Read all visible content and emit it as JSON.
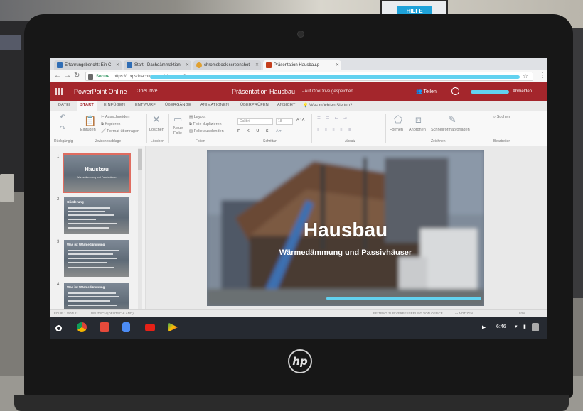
{
  "surroundings": {
    "help_label": "HILFE"
  },
  "laptop": {
    "brand": "hp"
  },
  "browser": {
    "tabs": [
      {
        "label": "Erfahrungsbericht: Ein C",
        "icon": "chart-icon",
        "color": "#2f6db5"
      },
      {
        "label": "Start - Dachdämmaktion -",
        "icon": "chart-icon",
        "color": "#2f6db5"
      },
      {
        "label": "chromebook screenshot",
        "icon": "chrome-icon",
        "color": "#e0a030"
      },
      {
        "label": "Präsentation Hausbau.p",
        "icon": "powerpoint-icon",
        "color": "#c43e1c"
      }
    ],
    "secure_label": "Secure",
    "url_fragment": "https://...xpsrlnachtwc.com/view.aspx?..."
  },
  "app": {
    "name": "PowerPoint Online",
    "onedrive": "OneDrive",
    "doc_title": "Präsentation Hausbau",
    "separator": "-",
    "save_state": "Auf OneDrive gespeichert",
    "share": "Teilen",
    "sign_out": "Abmelden"
  },
  "ribbon_tabs": [
    "DATEI",
    "START",
    "EINFÜGEN",
    "ENTWURF",
    "ÜBERGÄNGE",
    "ANIMATIONEN",
    "ÜBERPRÜFEN",
    "ANSICHT"
  ],
  "tell_me": "Was möchten Sie tun?",
  "ribbon": {
    "undo": "Rückgängig",
    "paste": "Einfügen",
    "cut": "Ausschneiden",
    "copy": "Kopieren",
    "format_painter": "Format übertragen",
    "clipboard": "Zwischenablage",
    "delete": "Löschen",
    "delete_group": "Löschen",
    "new_slide_1": "Neue",
    "new_slide_2": "Folie",
    "layout": "Layout",
    "duplicate": "Folie duplizieren",
    "hide": "Folie ausblenden",
    "slides_group": "Folien",
    "font_name": "Calibri",
    "font_size": "18",
    "font_group": "Schriftart",
    "paragraph_group": "Absatz",
    "shapes": "Formen",
    "arrange": "Anordnen",
    "quick_styles": "Schnellformatvorlagen",
    "drawing_group": "Zeichnen",
    "search": "Suchen",
    "edit_group": "Bearbeiten"
  },
  "slides": [
    {
      "num": "1",
      "title": "Hausbau",
      "subtitle": "Wärmedämmung und Passivhäuser"
    },
    {
      "num": "2",
      "heading": "Gliederung"
    },
    {
      "num": "3",
      "heading": "Was ist Wärmedämmung"
    },
    {
      "num": "4",
      "heading": "Was ist Wärmedämmung"
    }
  ],
  "main_slide": {
    "title": "Hausbau",
    "subtitle": "Wärmedämmung und Passivhäuser"
  },
  "status": {
    "slide_of": "FOLIE 1 VON 21",
    "language": "DEUTSCH (DEUTSCHLAND)",
    "feedback": "BEITRAG ZUR VERBESSERUNG VON OFFICE",
    "notes": "NOTIZEN",
    "zoom": "93%"
  },
  "shelf": {
    "apps": [
      {
        "name": "chrome-icon",
        "color": "#4285f4"
      },
      {
        "name": "gmail-icon",
        "color": "#e64a3b"
      },
      {
        "name": "docs-icon",
        "color": "#4c8cf5"
      },
      {
        "name": "youtube-icon",
        "color": "#e62117"
      },
      {
        "name": "play-store-icon",
        "color": "#34a853"
      }
    ],
    "time": "6:46"
  }
}
